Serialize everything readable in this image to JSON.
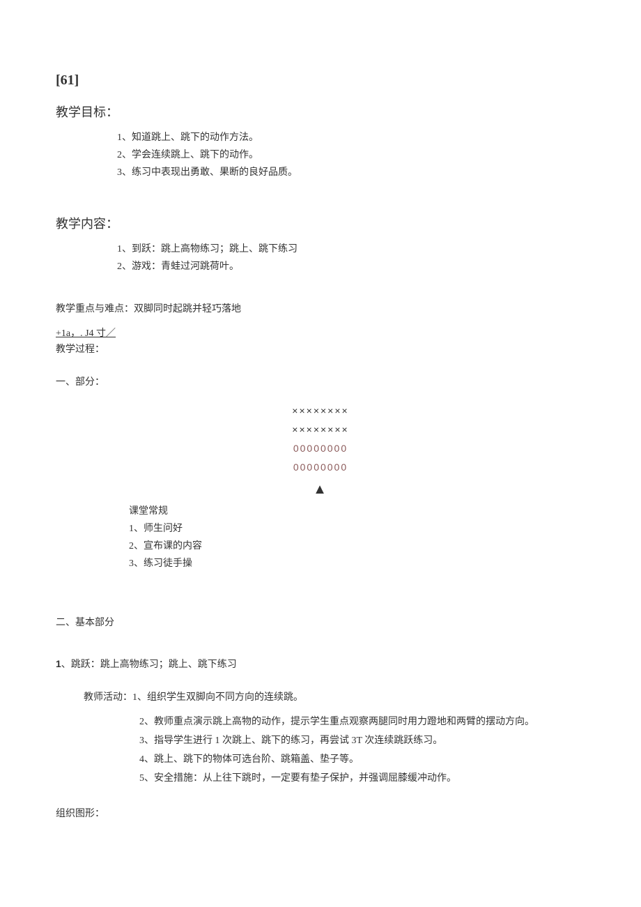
{
  "heading": "[61]",
  "goal": {
    "title": "教学目标：",
    "items": [
      "1、知道跳上、跳下的动作方法。",
      "2、学会连续跳上、跳下的动作。",
      "3、练习中表现出勇敢、果断的良好品质。"
    ]
  },
  "content": {
    "title": "教学内容：",
    "items": [
      "1、到跃：跳上高物练习；跳上、跳下练习",
      "2、游戏：青蛙过河跳荷叶。"
    ]
  },
  "keypoint": "教学重点与难点：双脚同时起跳并轻巧落地",
  "frag": "+1a，. J4 寸／",
  "process_label": "教学过程：",
  "part1": {
    "label": "一、部分：",
    "diagram": {
      "row1": "××××××××",
      "row2": "××××××××",
      "row3": "00000000",
      "row4": "00000000",
      "tri": "▲"
    },
    "routine_title": "课堂常规",
    "routine_items": [
      "1、师生问好",
      "2、宣布课的内容",
      "3、练习徒手操"
    ]
  },
  "part2": {
    "label": "二、基本部分",
    "sub_num": "1",
    "sub_title": "、跳跃：跳上高物练习；跳上、跳下练习",
    "teacher_lead": "教师活动：1、组织学生双脚向不同方向的连续跳。",
    "teacher_items": [
      "2、教师重点演示跳上高物的动作，提示学生重点观察两腿同时用力蹬地和两臂的摆动方向。",
      "3、指导学生进行 1 次跳上、跳下的练习，再尝试 3T 次连续跳跃练习。",
      "4、跳上、跳下的物体可选台阶、跳箱盖、垫子等。",
      "5、安全措施：从上往下跳时，一定要有垫子保护，并强调屈膝缓冲动作。"
    ]
  },
  "org_label": "组织图形："
}
